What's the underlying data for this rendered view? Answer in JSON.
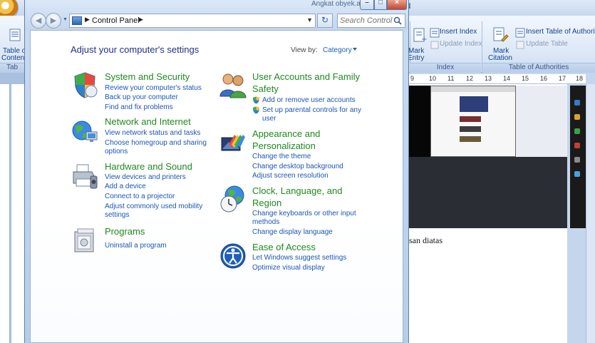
{
  "word": {
    "title_fragment": "ird",
    "ribbon": {
      "insert_index": "Insert Index",
      "update_index": "Update Index",
      "mark_entry_line1": "Mark",
      "mark_entry_line2": "Entry",
      "insert_toa": "Insert Table of Authoriti",
      "update_table": "Update Table",
      "mark_citation_line1": "Mark",
      "mark_citation_line2": "Citation",
      "toc_line1": "Table of",
      "toc_line2": "Content",
      "group_toc": "Tab",
      "group_index": "Index",
      "group_toa": "Table of Authorities"
    },
    "ruler_numbers": [
      "9",
      "10",
      "11",
      "12",
      "13",
      "14",
      "15",
      "16",
      "17",
      "18"
    ],
    "doc_text": "san diatas"
  },
  "control_panel": {
    "title_fragment": "Angkat obyek.atu",
    "address": {
      "location": "Control Panel",
      "search_placeholder": "Search Control ..."
    },
    "heading": "Adjust your computer's settings",
    "view_by_label": "View by:",
    "view_by_value": "Category",
    "categories_left": [
      {
        "title": "System and Security",
        "links": [
          "Review your computer's status",
          "Back up your computer",
          "Find and fix problems"
        ]
      },
      {
        "title": "Network and Internet",
        "links": [
          "View network status and tasks",
          "Choose homegroup and sharing",
          "options"
        ]
      },
      {
        "title": "Hardware and Sound",
        "links": [
          "View devices and printers",
          "Add a device",
          "Connect to a projector",
          "Adjust commonly used mobility",
          "settings"
        ]
      },
      {
        "title": "Programs",
        "links": [
          "Uninstall a program"
        ]
      }
    ],
    "categories_right": [
      {
        "title_line1": "User Accounts and Family",
        "title_line2": "Safety",
        "links": [
          "Add or remove user accounts",
          "Set up parental controls for any",
          "user"
        ]
      },
      {
        "title_line1": "Appearance and",
        "title_line2": "Personalization",
        "links": [
          "Change the theme",
          "Change desktop background",
          "Adjust screen resolution"
        ]
      },
      {
        "title_line1": "Clock, Language, and",
        "title_line2": "Region",
        "links": [
          "Change keyboards or other input",
          "methods",
          "Change display language"
        ]
      },
      {
        "title_line1": "Ease of Access",
        "links": [
          "Let Windows suggest settings",
          "Optimize visual display"
        ]
      }
    ]
  },
  "colors": {
    "category_title": "#1e8a1e",
    "link": "#1b56b4",
    "heading": "#1e3287"
  }
}
